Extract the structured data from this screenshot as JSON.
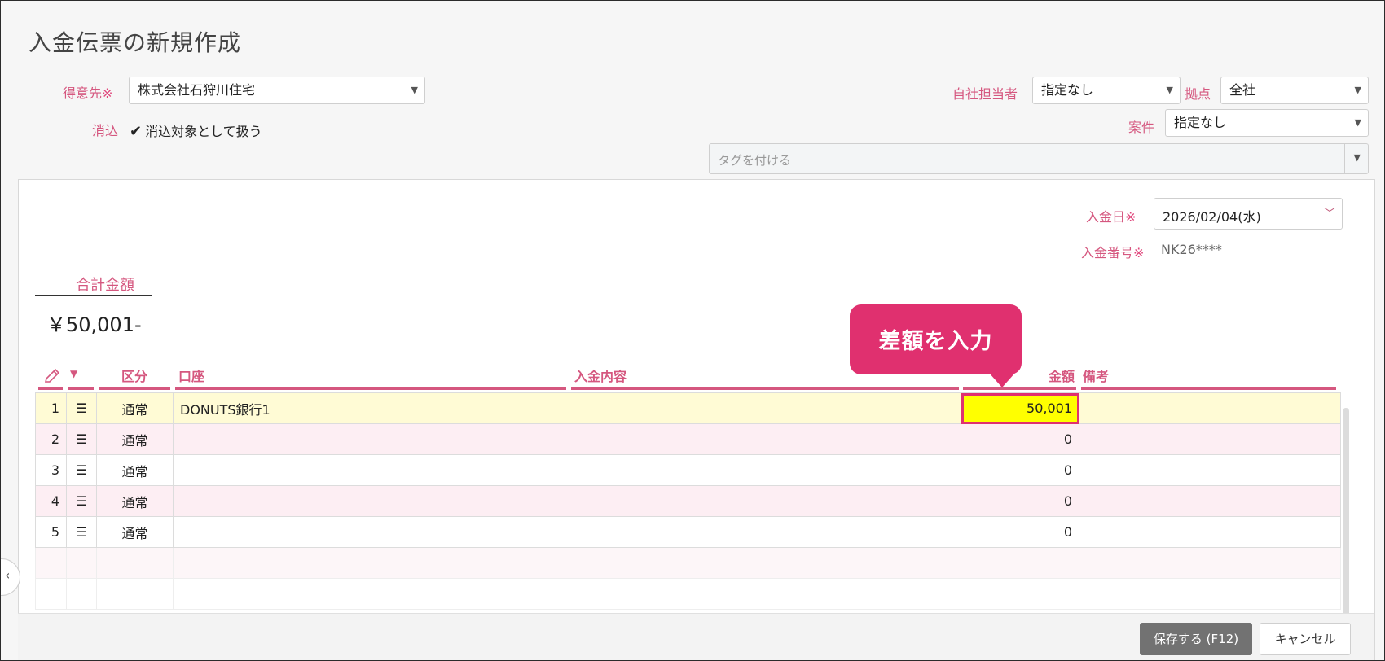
{
  "page": {
    "title": "入金伝票の新規作成"
  },
  "header": {
    "customer_label": "得意先",
    "customer_required": "※",
    "customer_value": "株式会社石狩川住宅",
    "reconcile_label": "消込",
    "reconcile_checkbox_label": "消込対象として扱う",
    "staff_label": "自社担当者",
    "staff_value": "指定なし",
    "branch_label": "拠点",
    "branch_value": "全社",
    "project_label": "案件",
    "project_value": "指定なし",
    "tag_placeholder": "タグを付ける"
  },
  "slip": {
    "date_label": "入金日",
    "date_required": "※",
    "date_value": "2026/02/04(水)",
    "number_label": "入金番号",
    "number_required": "※",
    "number_value": "NK26****",
    "total_label": "合計金額",
    "total_value": "￥50,001-"
  },
  "callout": {
    "text": "差額を入力"
  },
  "table": {
    "headers": {
      "type": "区分",
      "account": "口座",
      "content": "入金内容",
      "amount": "金額",
      "note": "備考"
    },
    "rows": [
      {
        "no": "1",
        "type": "通常",
        "account": "DONUTS銀行1",
        "content": "",
        "amount": "50,001",
        "note": ""
      },
      {
        "no": "2",
        "type": "通常",
        "account": "",
        "content": "",
        "amount": "0",
        "note": ""
      },
      {
        "no": "3",
        "type": "通常",
        "account": "",
        "content": "",
        "amount": "0",
        "note": ""
      },
      {
        "no": "4",
        "type": "通常",
        "account": "",
        "content": "",
        "amount": "0",
        "note": ""
      },
      {
        "no": "5",
        "type": "通常",
        "account": "",
        "content": "",
        "amount": "0",
        "note": ""
      }
    ]
  },
  "footer": {
    "save_label": "保存する (F12)",
    "cancel_label": "キャンセル"
  },
  "icons": {
    "edit": "pencil-icon",
    "sort": "caret-down-icon",
    "row_menu": "hamburger-icon"
  }
}
